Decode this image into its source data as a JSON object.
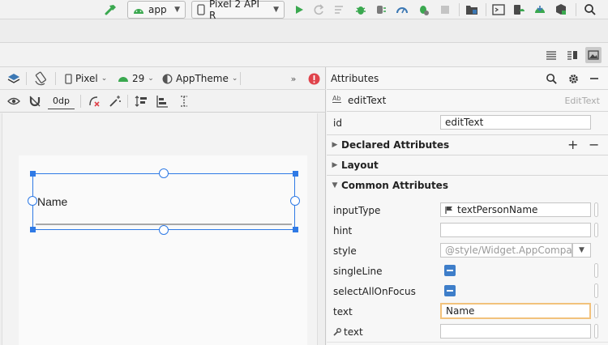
{
  "toolbar": {
    "module": "app",
    "device": "Pixel 2 API R"
  },
  "design": {
    "device": "Pixel",
    "api": "29",
    "theme": "AppTheme",
    "margin": "0dp",
    "edittext_text": "Name"
  },
  "attributes": {
    "panel_title": "Attributes",
    "component_name": "editText",
    "component_class": "EditText",
    "id_label": "id",
    "id_value": "editText",
    "sections": {
      "declared": "Declared Attributes",
      "layout": "Layout",
      "common": "Common Attributes"
    },
    "rows": {
      "inputType": {
        "label": "inputType",
        "value": "textPersonName"
      },
      "hint": {
        "label": "hint",
        "value": ""
      },
      "style": {
        "label": "style",
        "placeholder": "@style/Widget.AppCompat."
      },
      "singleLine": {
        "label": "singleLine"
      },
      "selectAllOnFocus": {
        "label": "selectAllOnFocus"
      },
      "text": {
        "label": "text",
        "value": "Name"
      },
      "tools_text": {
        "label": "text",
        "value": ""
      }
    }
  },
  "colors": {
    "accent": "#2f7ae5",
    "run_green": "#3aa84f",
    "error_red": "#e0434b",
    "focus_orange": "#f2c27c"
  }
}
